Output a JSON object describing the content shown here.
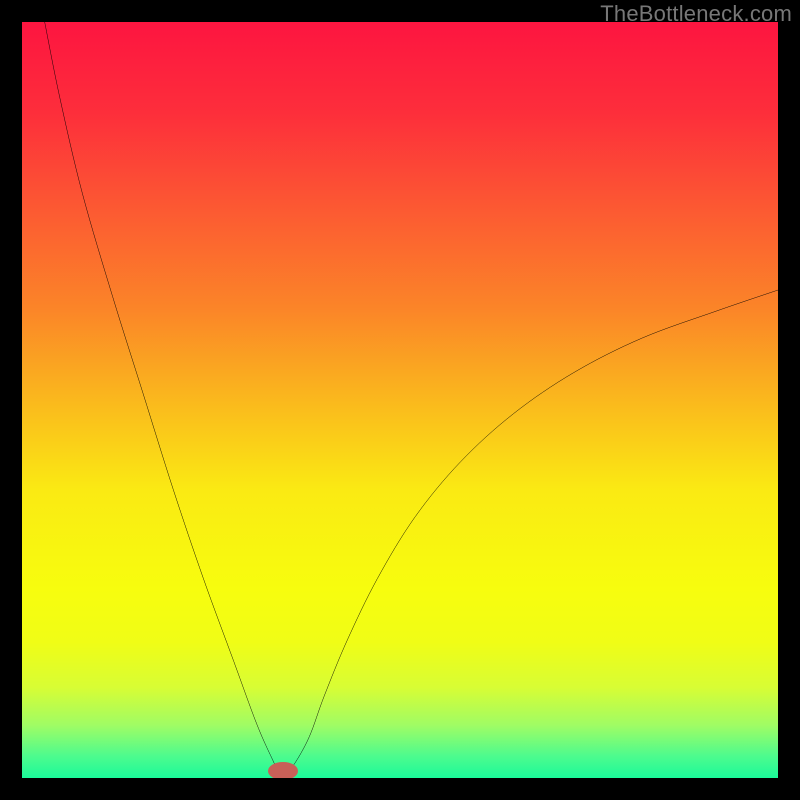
{
  "watermark": "TheBottleneck.com",
  "chart_data": {
    "type": "line",
    "title": "",
    "xlabel": "",
    "ylabel": "",
    "xlim": [
      0,
      100
    ],
    "ylim": [
      0,
      110
    ],
    "grid": false,
    "series": [
      {
        "name": "bottleneck-curve",
        "x": [
          3,
          5,
          8,
          12,
          16,
          20,
          24,
          28,
          31,
          33,
          34,
          35,
          36,
          38,
          40,
          43,
          47,
          52,
          58,
          65,
          73,
          82,
          92,
          100
        ],
        "y": [
          110,
          99,
          85,
          70,
          56,
          42,
          29,
          17,
          8,
          3,
          1,
          1,
          2,
          6,
          12,
          20,
          29,
          38,
          46,
          53,
          59,
          64,
          68,
          71
        ]
      }
    ],
    "marker": {
      "x": 34.5,
      "y": 1,
      "color": "#c86058",
      "rx": 15,
      "ry": 9
    },
    "gradient_stops": [
      {
        "offset": 0.0,
        "color": "#fd1540"
      },
      {
        "offset": 0.12,
        "color": "#fd2e3b"
      },
      {
        "offset": 0.25,
        "color": "#fc5a32"
      },
      {
        "offset": 0.38,
        "color": "#fb8528"
      },
      {
        "offset": 0.5,
        "color": "#fab81d"
      },
      {
        "offset": 0.62,
        "color": "#faea13"
      },
      {
        "offset": 0.75,
        "color": "#f7fd0e"
      },
      {
        "offset": 0.82,
        "color": "#f0fd16"
      },
      {
        "offset": 0.88,
        "color": "#d8fd34"
      },
      {
        "offset": 0.93,
        "color": "#a0fc64"
      },
      {
        "offset": 0.97,
        "color": "#4ffb8d"
      },
      {
        "offset": 1.0,
        "color": "#1bfa9a"
      }
    ]
  }
}
